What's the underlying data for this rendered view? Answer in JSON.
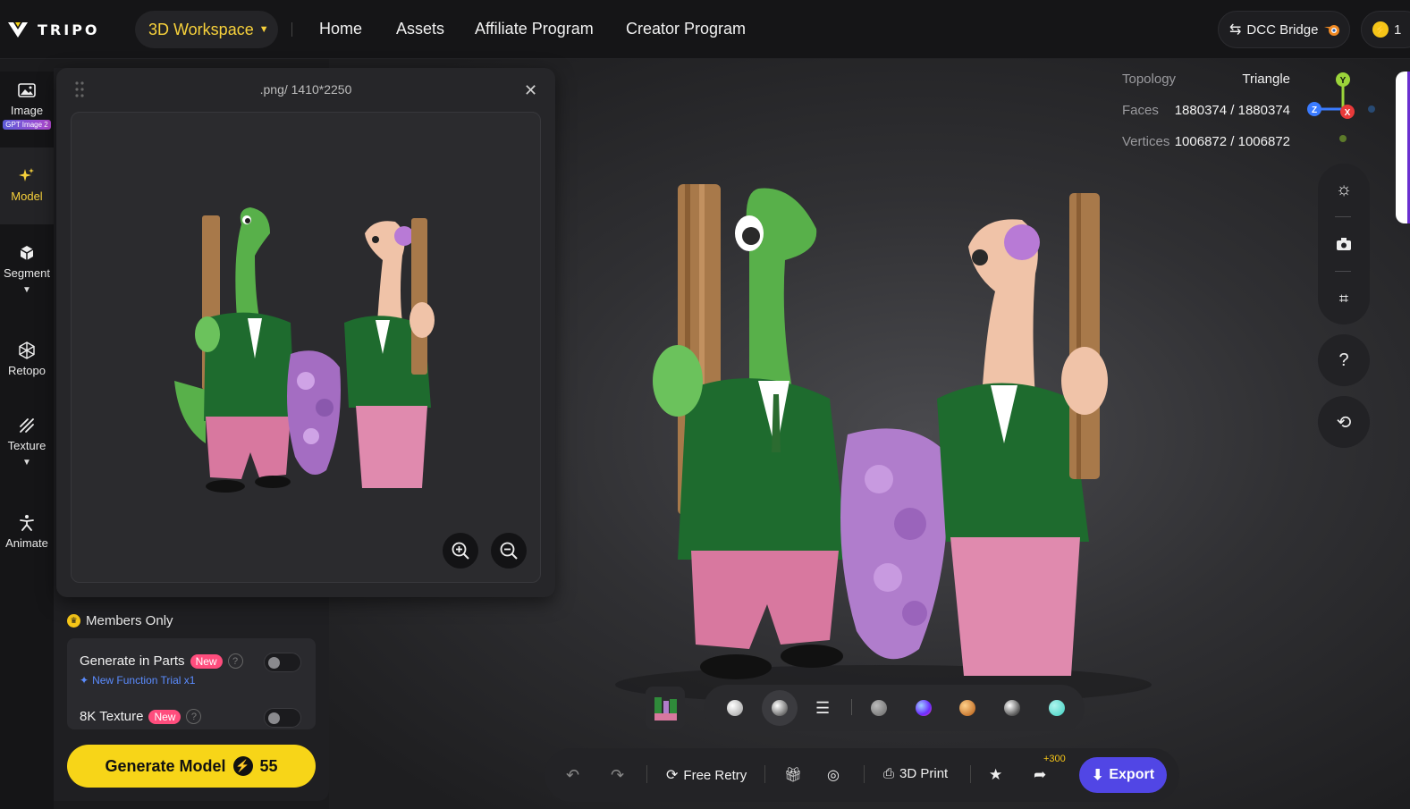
{
  "brand": {
    "name": "TRIPO"
  },
  "header": {
    "workspace_label": "3D Workspace",
    "nav": [
      "Home",
      "Assets",
      "Affiliate Program",
      "Creator Program"
    ],
    "dcc_label": "DCC Bridge",
    "credits_value": "1"
  },
  "rail": {
    "items": [
      {
        "label": "Image",
        "badge": "GPT Image 2"
      },
      {
        "label": "Model"
      },
      {
        "label": "Segment"
      },
      {
        "label": "Retopo"
      },
      {
        "label": "Texture"
      },
      {
        "label": "Animate"
      }
    ]
  },
  "preview": {
    "title": ".png/ 1410*2250"
  },
  "panel": {
    "members_label": "Members Only",
    "generate_parts_label": "Generate in Parts",
    "new_badge": "New",
    "trial_label": "New Function Trial x1",
    "texture_8k_label": "8K Texture",
    "generate_button": "Generate Model",
    "generate_cost": "55"
  },
  "stats": {
    "topology_label": "Topology",
    "topology_value": "Triangle",
    "faces_label": "Faces",
    "faces_value": "1880374 / 1880374",
    "vertices_label": "Vertices",
    "vertices_value": "1006872 / 1006872"
  },
  "gizmo": {
    "y": "Y",
    "x": "X",
    "z": "Z"
  },
  "help_label": "?",
  "actions": {
    "free_retry": "Free Retry",
    "print_3d": "3D Print",
    "bonus": "+300",
    "export": "Export"
  },
  "colors": {
    "accent_yellow": "#f7d518",
    "export_purple": "#5146e5",
    "new_badge": "#ff4d7d",
    "trial_blue": "#5b8cff"
  }
}
